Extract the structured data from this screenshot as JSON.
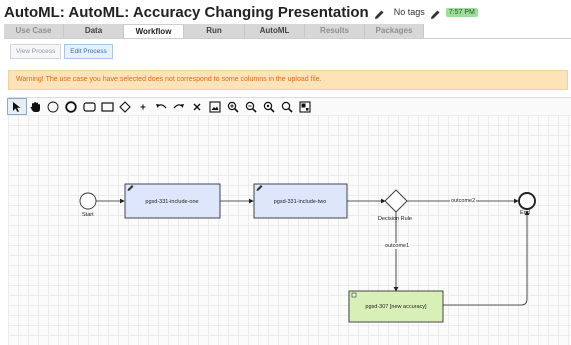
{
  "header": {
    "title": "AutoML: AutoML: Accuracy Changing Presentation",
    "tags_label": "No tags",
    "time_badge": "7:57 PM"
  },
  "tabs": [
    {
      "label": "Use Case",
      "state": "disabled"
    },
    {
      "label": "Data",
      "state": "enabled"
    },
    {
      "label": "Workflow",
      "state": "active"
    },
    {
      "label": "Run",
      "state": "enabled"
    },
    {
      "label": "AutoML",
      "state": "enabled"
    },
    {
      "label": "Results",
      "state": "disabled"
    },
    {
      "label": "Packages",
      "state": "disabled"
    }
  ],
  "subtabs": {
    "view": "View Process",
    "edit": "Edit Process"
  },
  "warning": "Warning! The use case you have selected does not correspond to some columns in the upload file.",
  "toolbar": {
    "tools": [
      "pointer-icon",
      "hand-icon",
      "start-event-icon",
      "end-event-icon",
      "task-icon",
      "subprocess-icon",
      "gateway-icon",
      "plus-icon",
      "undo-icon",
      "redo-icon",
      "delete-icon",
      "image-icon",
      "zoom-in-icon",
      "zoom-out-icon",
      "zoom-fit-icon",
      "zoom-reset-icon",
      "minimap-icon"
    ],
    "selected": "pointer-icon"
  },
  "diagram": {
    "start_label": "Start",
    "end_label": "End",
    "task1": "pgsd-331-include-one",
    "task2": "pgsd-331-include-two",
    "gateway_label": "Decision Rule",
    "flow_outcome2": "outcome2",
    "flow_outcome1": "outcome1",
    "task3": "pgsd-307 [new accuracy]"
  },
  "colors": {
    "task_fill": "#dde6fb",
    "task_green_fill": "#d8f0b8",
    "warning_bg": "#fde3b8",
    "warning_text": "#e06b16"
  }
}
